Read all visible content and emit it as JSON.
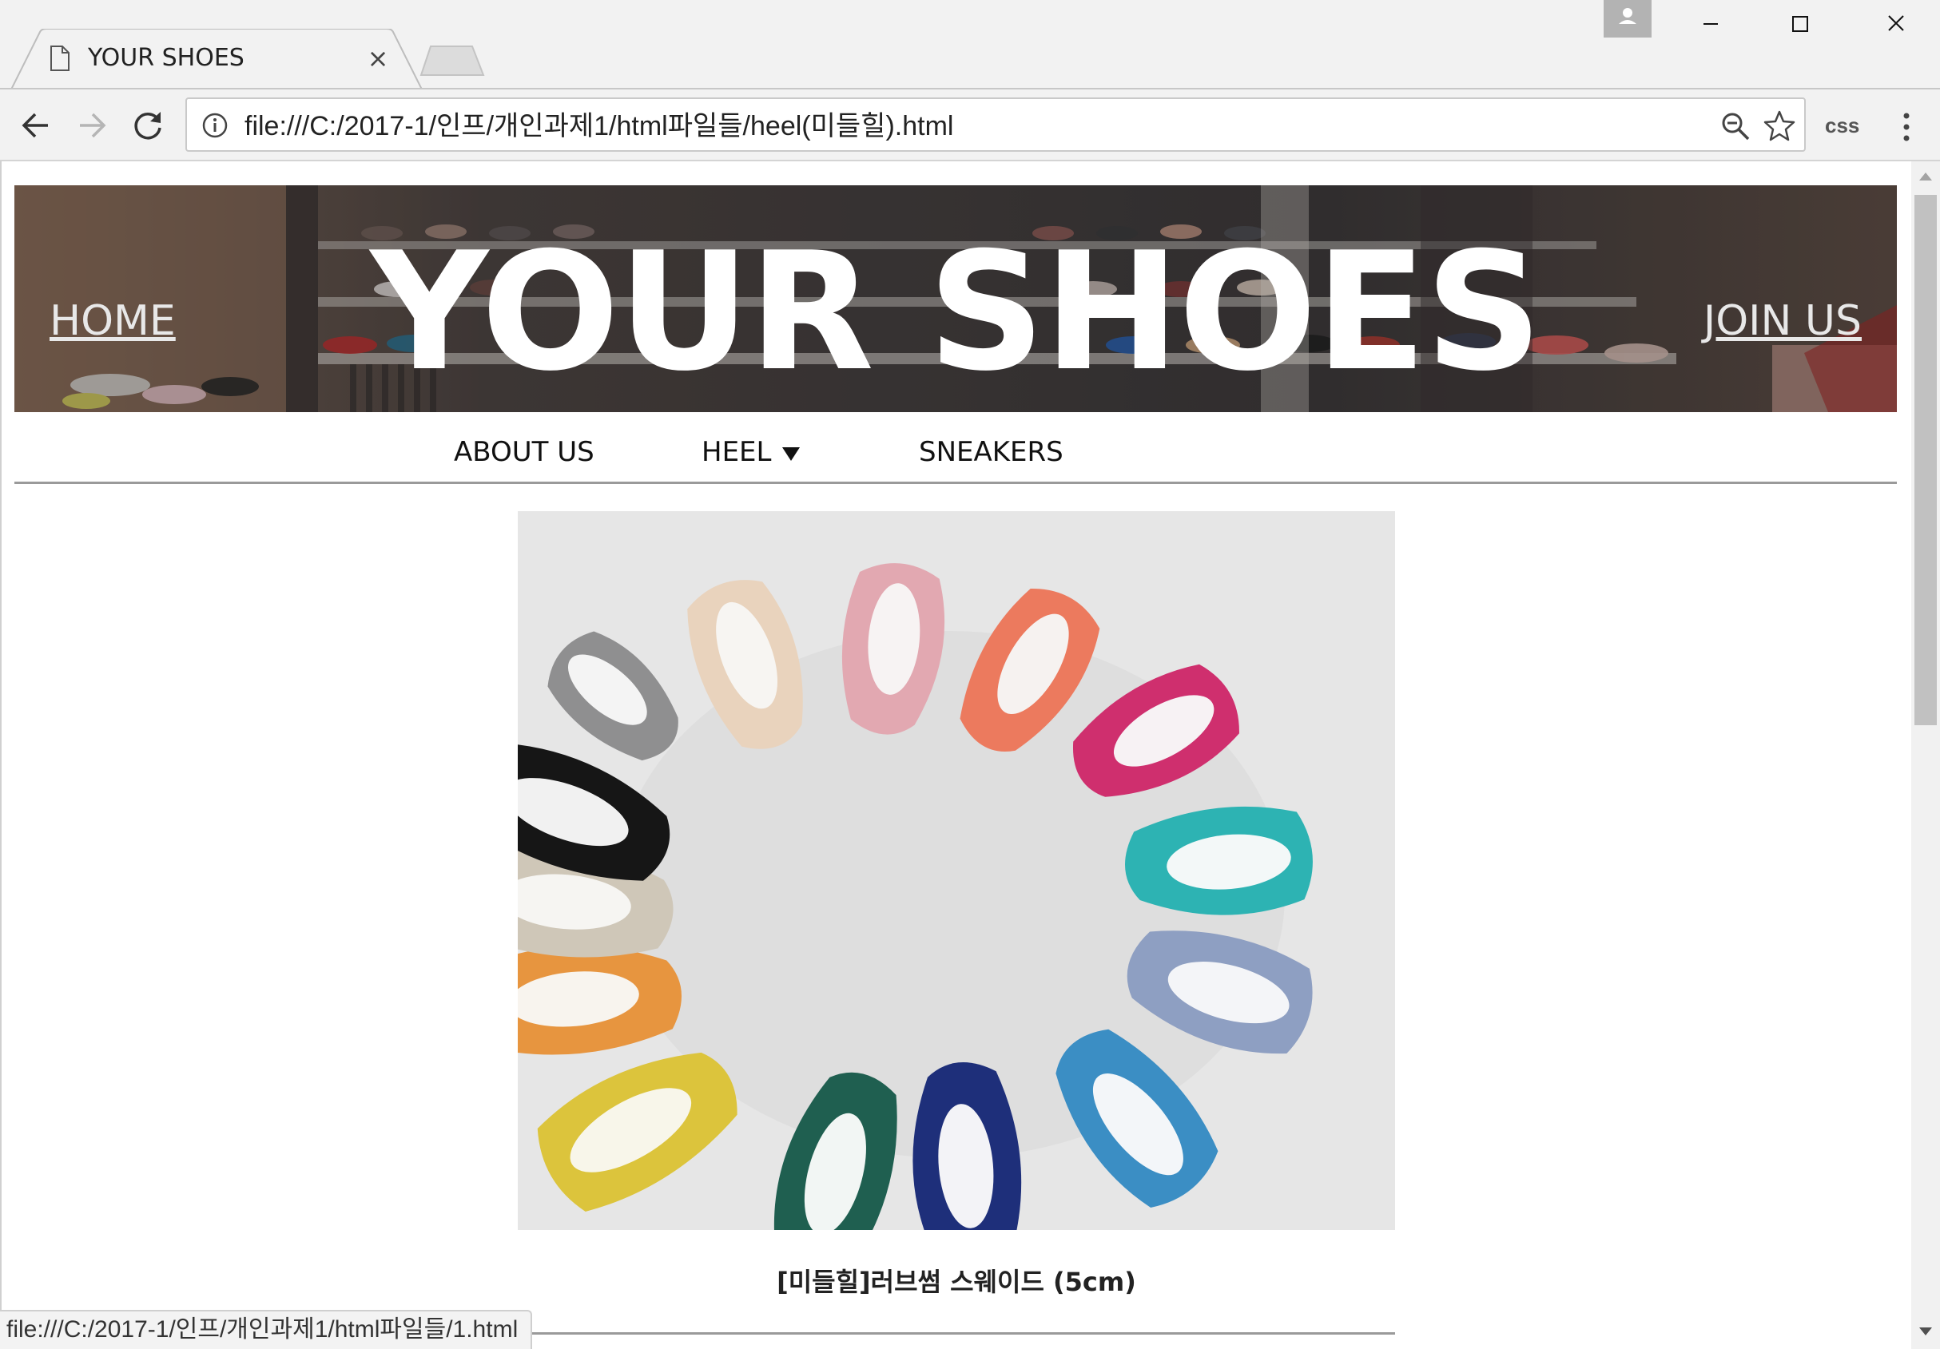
{
  "browser": {
    "tab_title": "YOUR SHOES",
    "tab_close_glyph": "×",
    "url": "file:///C:/2017-1/인프/개인과제1/html파일들/heel(미들힐).html",
    "extension_label": "css",
    "status_url": "file:///C:/2017-1/인프/개인과제1/html파일들/1.html",
    "icons": [
      "page-icon",
      "close-icon",
      "profile-icon",
      "minimize-icon",
      "maximize-icon",
      "window-close-icon",
      "back-icon",
      "forward-icon",
      "reload-icon",
      "info-icon",
      "zoom-icon",
      "star-icon",
      "menu-icon"
    ]
  },
  "header": {
    "home_link": "HOME",
    "site_title": "YOUR SHOES",
    "join_link": "JOIN US"
  },
  "menu": {
    "items": [
      {
        "label": "ABOUT US"
      },
      {
        "label": "HEEL",
        "icon": "caret-down-icon"
      },
      {
        "label": "SNEAKERS"
      }
    ]
  },
  "product": {
    "name": "[미들힐]러브썸 스웨이드 (5cm)"
  },
  "colors": {
    "banner_text": "#ffffff",
    "page_background": "#ffffff",
    "chrome_background": "#f2f2f2",
    "divider": "#9a9a9a"
  }
}
